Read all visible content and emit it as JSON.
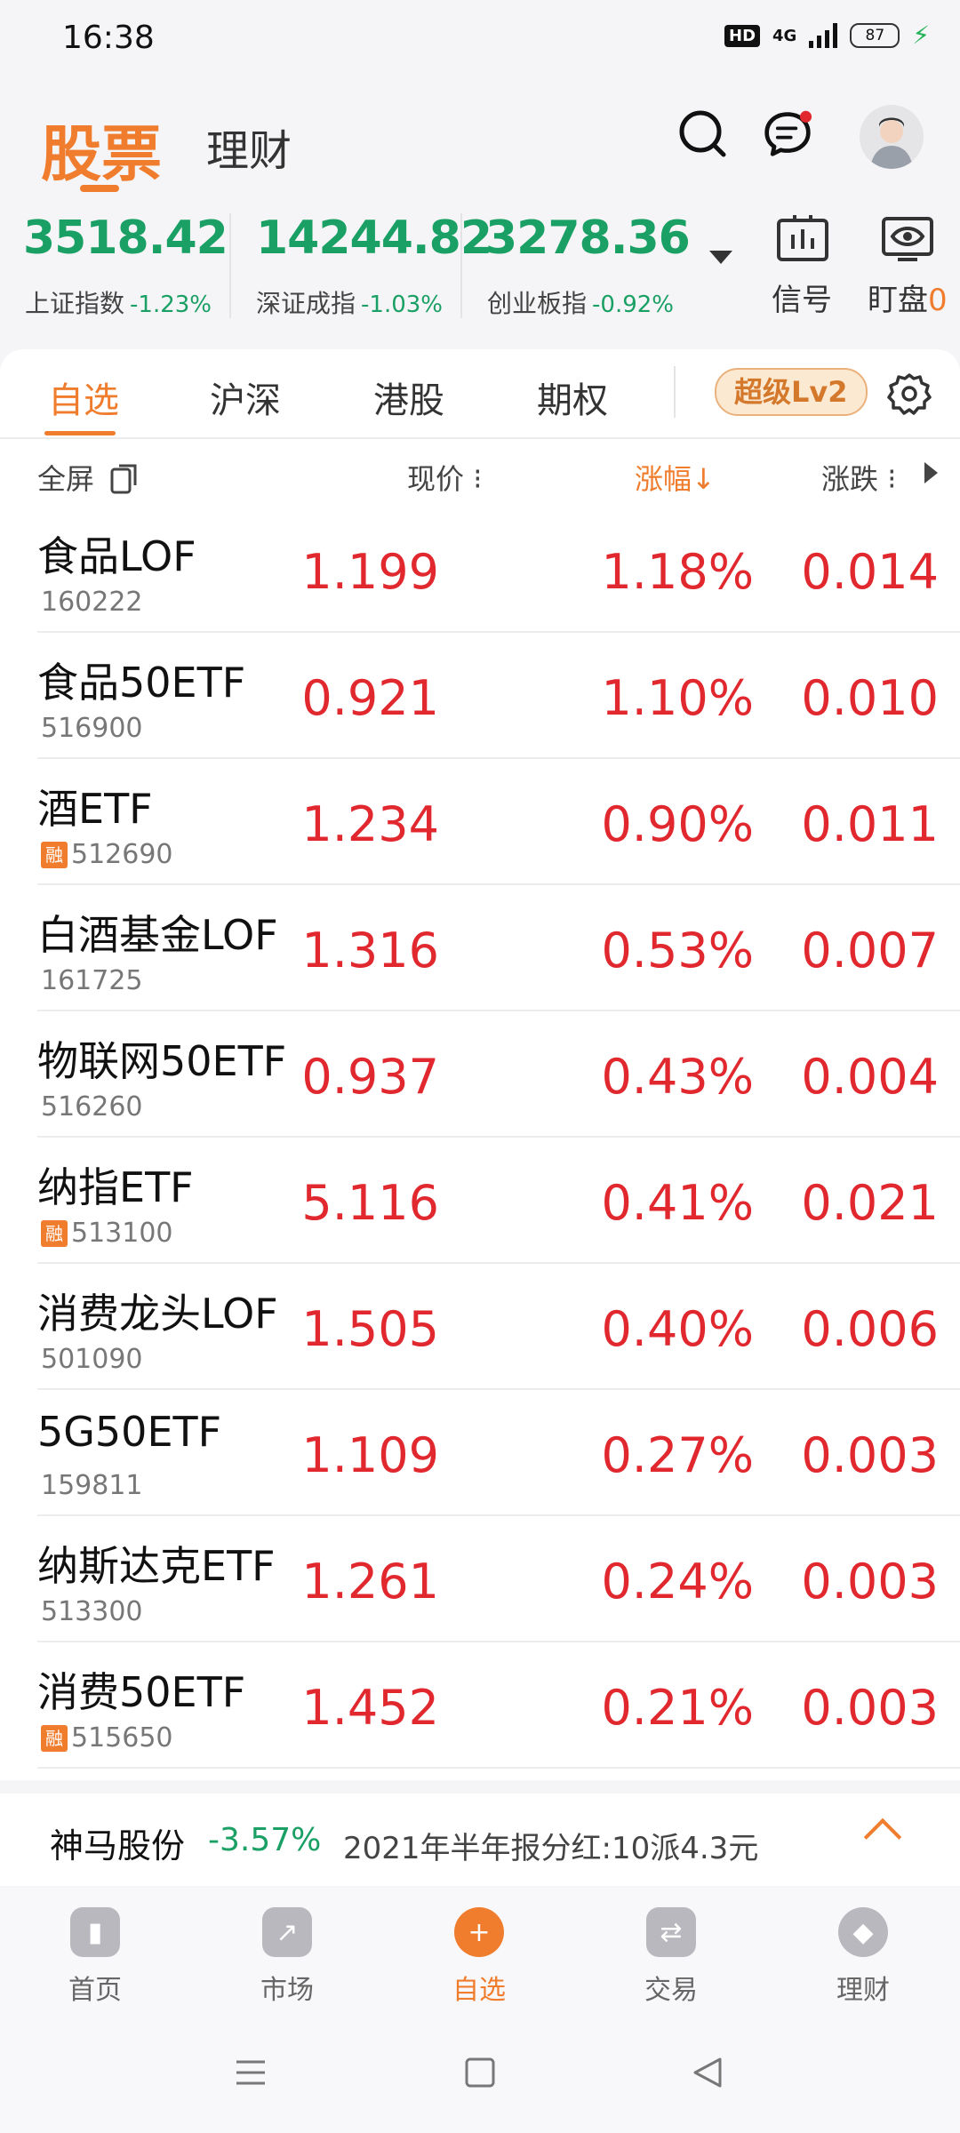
{
  "status_bar": {
    "time": "16:38",
    "hd": "HD",
    "network": "4G",
    "battery": "87"
  },
  "header": {
    "tab_stocks": "股票",
    "tab_wealth": "理财"
  },
  "indices": [
    {
      "value": "3518.42",
      "name": "上证指数",
      "change": "-1.23%"
    },
    {
      "value": "14244.82",
      "name": "深证成指",
      "change": "-1.03%"
    },
    {
      "value": "3278.36",
      "name": "创业板指",
      "change": "-0.92%"
    }
  ],
  "tools": {
    "signal_label": "信号",
    "watch_label": "盯盘",
    "watch_count": "0"
  },
  "categories": {
    "items": [
      "自选",
      "沪深",
      "港股",
      "期权"
    ],
    "badge": "超级Lv2"
  },
  "columns": {
    "fullscreen": "全屏",
    "price": "现价",
    "pct": "涨幅",
    "change": "涨跌"
  },
  "rows": [
    {
      "name": "食品LOF",
      "code": "160222",
      "margin": false,
      "price": "1.199",
      "pct": "1.18%",
      "change": "0.014"
    },
    {
      "name": "食品50ETF",
      "code": "516900",
      "margin": false,
      "price": "0.921",
      "pct": "1.10%",
      "change": "0.010"
    },
    {
      "name": "酒ETF",
      "code": "512690",
      "margin": true,
      "price": "1.234",
      "pct": "0.90%",
      "change": "0.011"
    },
    {
      "name": "白酒基金LOF",
      "code": "161725",
      "margin": false,
      "price": "1.316",
      "pct": "0.53%",
      "change": "0.007"
    },
    {
      "name": "物联网50ETF",
      "code": "516260",
      "margin": false,
      "price": "0.937",
      "pct": "0.43%",
      "change": "0.004"
    },
    {
      "name": "纳指ETF",
      "code": "513100",
      "margin": true,
      "price": "5.116",
      "pct": "0.41%",
      "change": "0.021"
    },
    {
      "name": "消费龙头LOF",
      "code": "501090",
      "margin": false,
      "price": "1.505",
      "pct": "0.40%",
      "change": "0.006"
    },
    {
      "name": "5G50ETF",
      "code": "159811",
      "margin": false,
      "price": "1.109",
      "pct": "0.27%",
      "change": "0.003"
    },
    {
      "name": "纳斯达克ETF",
      "code": "513300",
      "margin": false,
      "price": "1.261",
      "pct": "0.24%",
      "change": "0.003"
    },
    {
      "name": "消费50ETF",
      "code": "515650",
      "margin": true,
      "price": "1.452",
      "pct": "0.21%",
      "change": "0.003"
    }
  ],
  "margin_tag": "融",
  "banner": {
    "name": "神马股份",
    "change": "-3.57%",
    "text": "2021年半年报分红:10派4.3元"
  },
  "nav": {
    "home": "首页",
    "market": "市场",
    "favorites": "自选",
    "trade": "交易",
    "wealth": "理财"
  },
  "colors": {
    "accent": "#f07c2d",
    "up": "#e0282e",
    "down": "#1aa064"
  }
}
